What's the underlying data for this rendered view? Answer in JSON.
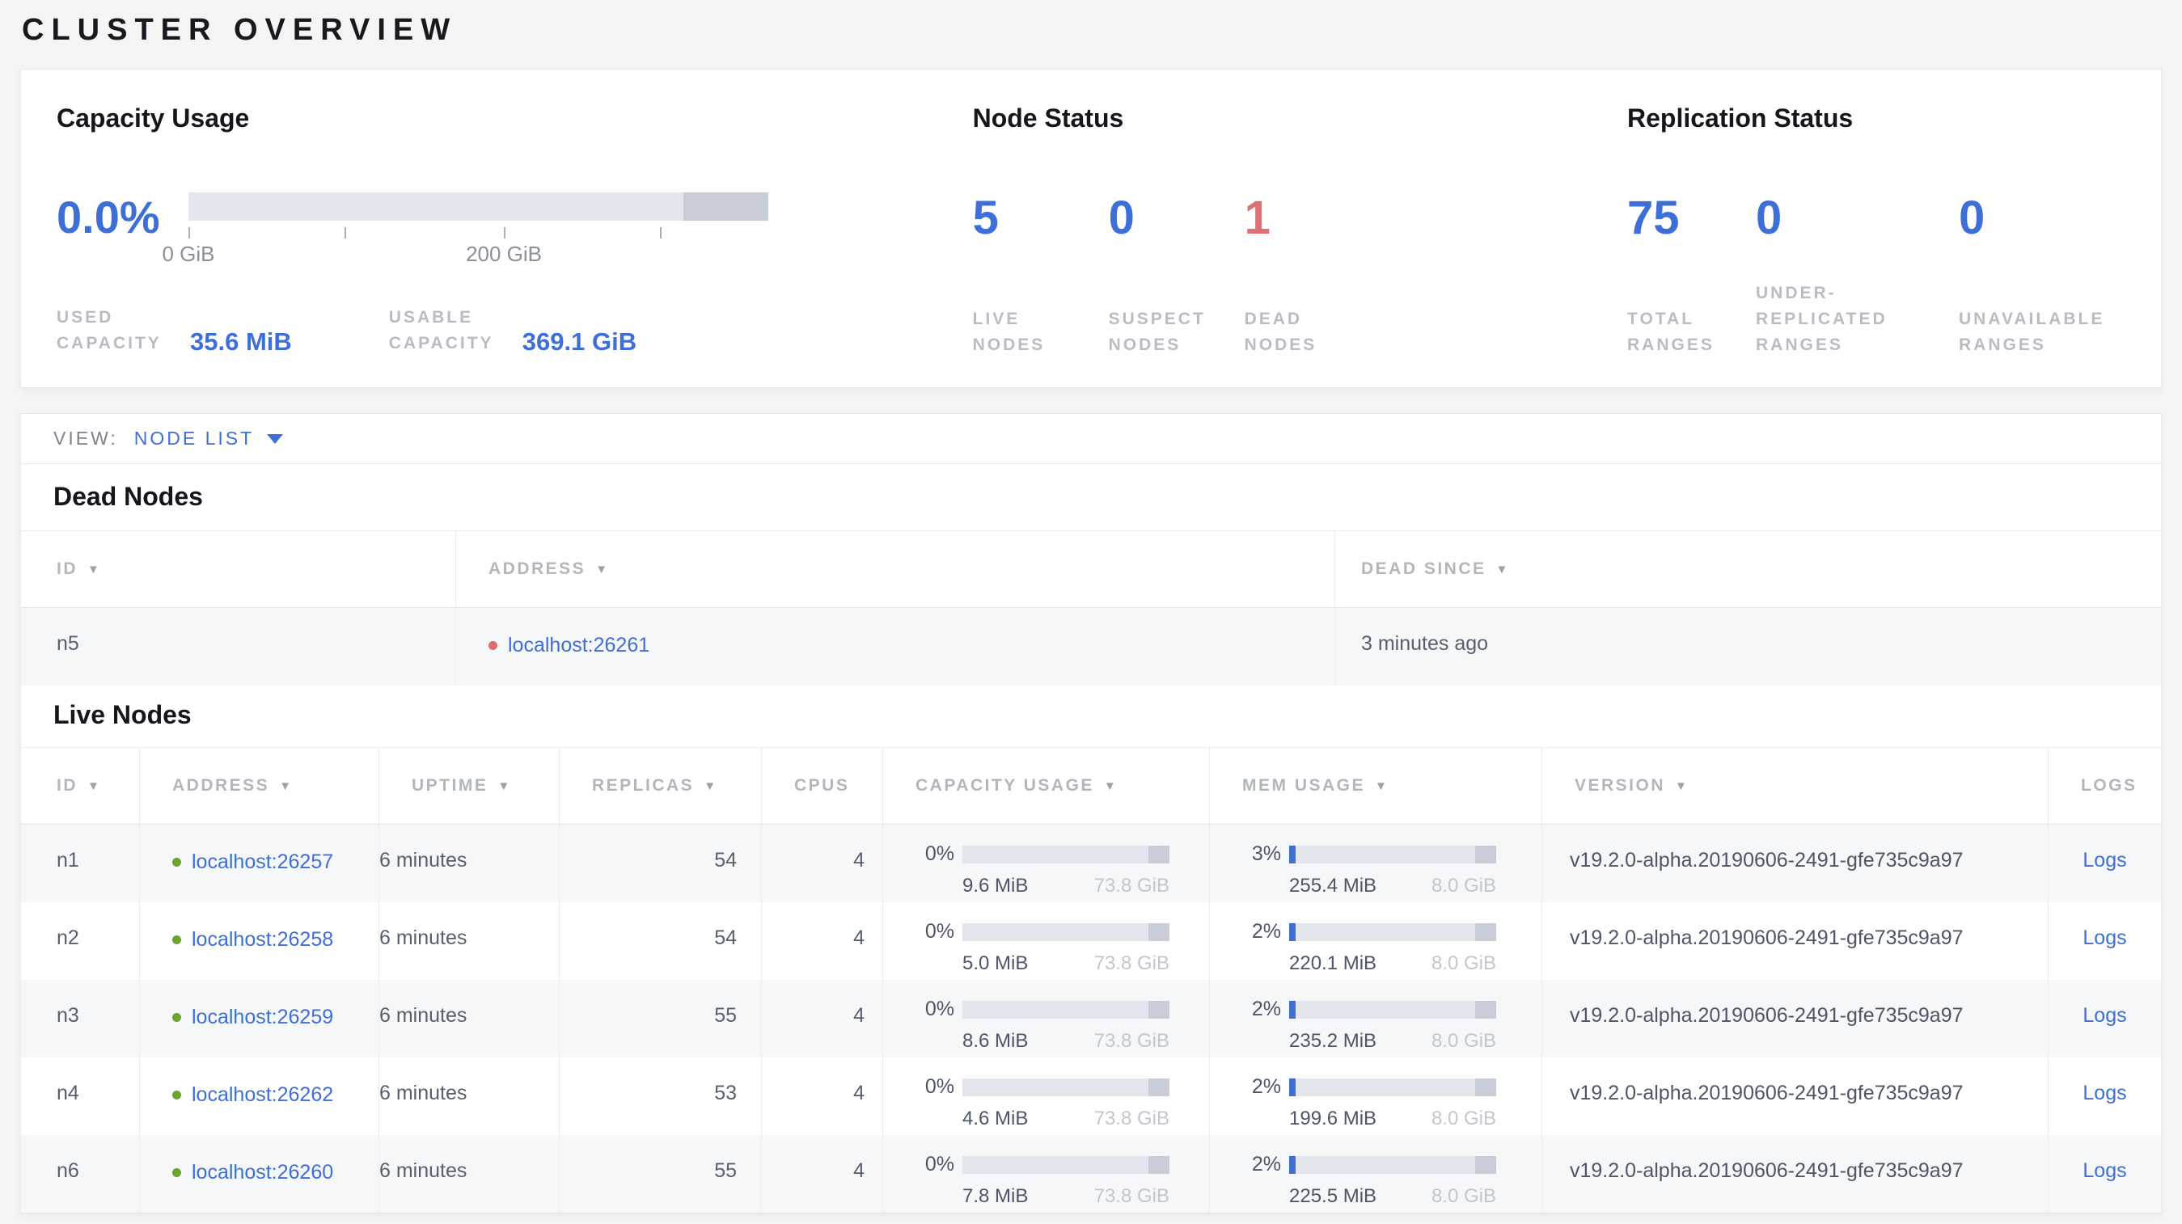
{
  "page": {
    "title": "CLUSTER OVERVIEW"
  },
  "colors": {
    "accent_blue": "#3e6fd8",
    "danger_red": "#de7173",
    "green_dot": "#6da32f",
    "red_dot": "#de6e6e",
    "label_gray": "#b9bcc3",
    "bar_track": "#e4e6ed",
    "bar_dark": "#c9cdd7"
  },
  "overview": {
    "capacity": {
      "title": "Capacity Usage",
      "percent": "0.0%",
      "used_label": "USED CAPACITY",
      "used_value": "35.6 MiB",
      "usable_label": "USABLE CAPACITY",
      "usable_value": "369.1 GiB",
      "bar": {
        "fill_pct": 0,
        "dark_start_pct": 85.4,
        "ticks": [
          {
            "pos_pct": 0,
            "label": "0 GiB"
          },
          {
            "pos_pct": 26.9,
            "label": ""
          },
          {
            "pos_pct": 54.4,
            "label": "200 GiB"
          },
          {
            "pos_pct": 81.3,
            "label": ""
          }
        ]
      }
    },
    "node_status": {
      "title": "Node Status",
      "stats": [
        {
          "value": "5",
          "label": "LIVE NODES",
          "tone": "blue"
        },
        {
          "value": "0",
          "label": "SUSPECT NODES",
          "tone": "blue"
        },
        {
          "value": "1",
          "label": "DEAD NODES",
          "tone": "red"
        }
      ]
    },
    "replication": {
      "title": "Replication Status",
      "stats": [
        {
          "value": "75",
          "label": "TOTAL RANGES",
          "tone": "blue"
        },
        {
          "value": "0",
          "label": "UNDER-REPLICATED RANGES",
          "tone": "blue"
        },
        {
          "value": "0",
          "label": "UNAVAILABLE RANGES",
          "tone": "blue"
        }
      ]
    }
  },
  "view_bar": {
    "label": "VIEW:",
    "selected": "NODE LIST"
  },
  "dead_nodes": {
    "title": "Dead Nodes",
    "columns": [
      {
        "label": "ID",
        "sortable": true
      },
      {
        "label": "ADDRESS",
        "sortable": true
      },
      {
        "label": "DEAD SINCE",
        "sortable": true
      }
    ],
    "rows": [
      {
        "id": "n5",
        "address": "localhost:26261",
        "dead_since": "3 minutes ago"
      }
    ]
  },
  "live_nodes": {
    "title": "Live Nodes",
    "cell_bar_dark_start_pct": 90,
    "columns": [
      {
        "label": "ID",
        "sortable": true
      },
      {
        "label": "ADDRESS",
        "sortable": true
      },
      {
        "label": "UPTIME",
        "sortable": true
      },
      {
        "label": "REPLICAS",
        "sortable": true
      },
      {
        "label": "CPUS",
        "sortable": false
      },
      {
        "label": "CAPACITY USAGE",
        "sortable": true
      },
      {
        "label": "MEM USAGE",
        "sortable": true
      },
      {
        "label": "VERSION",
        "sortable": true
      },
      {
        "label": "LOGS",
        "sortable": false
      }
    ],
    "rows": [
      {
        "id": "n1",
        "address": "localhost:26257",
        "uptime": "6 minutes",
        "replicas": "54",
        "cpus": "4",
        "capacity": {
          "percent": "0%",
          "fill_pct": 0,
          "used": "9.6 MiB",
          "total": "73.8 GiB"
        },
        "memory": {
          "percent": "3%",
          "fill_pct": 3,
          "used": "255.4 MiB",
          "total": "8.0 GiB"
        },
        "version": "v19.2.0-alpha.20190606-2491-gfe735c9a97",
        "logs_label": "Logs"
      },
      {
        "id": "n2",
        "address": "localhost:26258",
        "uptime": "6 minutes",
        "replicas": "54",
        "cpus": "4",
        "capacity": {
          "percent": "0%",
          "fill_pct": 0,
          "used": "5.0 MiB",
          "total": "73.8 GiB"
        },
        "memory": {
          "percent": "2%",
          "fill_pct": 2,
          "used": "220.1 MiB",
          "total": "8.0 GiB"
        },
        "version": "v19.2.0-alpha.20190606-2491-gfe735c9a97",
        "logs_label": "Logs"
      },
      {
        "id": "n3",
        "address": "localhost:26259",
        "uptime": "6 minutes",
        "replicas": "55",
        "cpus": "4",
        "capacity": {
          "percent": "0%",
          "fill_pct": 0,
          "used": "8.6 MiB",
          "total": "73.8 GiB"
        },
        "memory": {
          "percent": "2%",
          "fill_pct": 2,
          "used": "235.2 MiB",
          "total": "8.0 GiB"
        },
        "version": "v19.2.0-alpha.20190606-2491-gfe735c9a97",
        "logs_label": "Logs"
      },
      {
        "id": "n4",
        "address": "localhost:26262",
        "uptime": "6 minutes",
        "replicas": "53",
        "cpus": "4",
        "capacity": {
          "percent": "0%",
          "fill_pct": 0,
          "used": "4.6 MiB",
          "total": "73.8 GiB"
        },
        "memory": {
          "percent": "2%",
          "fill_pct": 2,
          "used": "199.6 MiB",
          "total": "8.0 GiB"
        },
        "version": "v19.2.0-alpha.20190606-2491-gfe735c9a97",
        "logs_label": "Logs"
      },
      {
        "id": "n6",
        "address": "localhost:26260",
        "uptime": "6 minutes",
        "replicas": "55",
        "cpus": "4",
        "capacity": {
          "percent": "0%",
          "fill_pct": 0,
          "used": "7.8 MiB",
          "total": "73.8 GiB"
        },
        "memory": {
          "percent": "2%",
          "fill_pct": 2,
          "used": "225.5 MiB",
          "total": "8.0 GiB"
        },
        "version": "v19.2.0-alpha.20190606-2491-gfe735c9a97",
        "logs_label": "Logs"
      }
    ]
  }
}
